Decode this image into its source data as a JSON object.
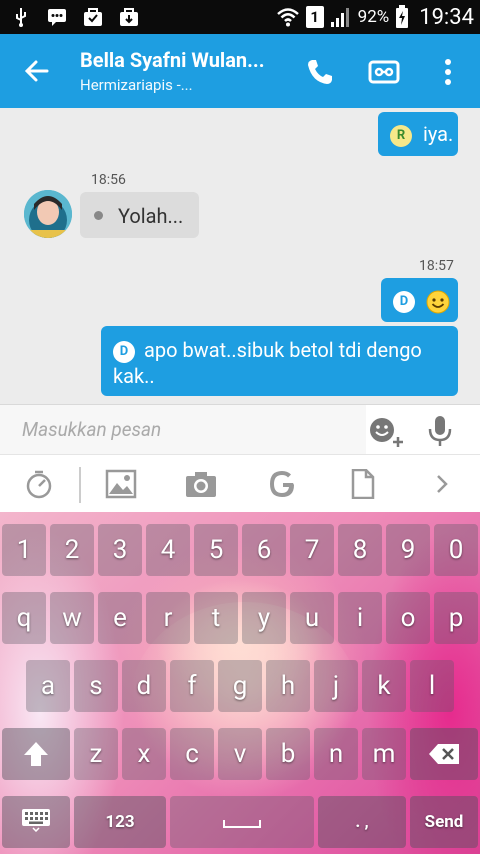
{
  "status_bar": {
    "battery_percent": "92%",
    "time": "19:34",
    "sim_slot": "1",
    "icons": [
      "usb-icon",
      "chat-notification-icon",
      "bag-icon",
      "bag-icon",
      "wifi-icon",
      "sim-icon",
      "signal-icon",
      "battery-icon"
    ]
  },
  "app_bar": {
    "title": "Bella Syafni Wulan...",
    "subtitle": "Hermizariapis -...",
    "accent": "#1e9ee1"
  },
  "messages": [
    {
      "direction": "out",
      "badge": "R",
      "text": "iya."
    },
    {
      "direction": "in",
      "time": "18:56",
      "text": "Yolah..."
    },
    {
      "direction": "out",
      "time": "18:57",
      "badge": "D",
      "text": ""
    },
    {
      "direction": "out",
      "badge": "D",
      "text": "apo bwat..sibuk betol tdi dengo kak.."
    }
  ],
  "composer": {
    "placeholder": "Masukkan pesan"
  },
  "keyboard": {
    "row1": [
      "1",
      "2",
      "3",
      "4",
      "5",
      "6",
      "7",
      "8",
      "9",
      "0"
    ],
    "row2": [
      "q",
      "w",
      "e",
      "r",
      "t",
      "y",
      "u",
      "i",
      "o",
      "p"
    ],
    "row3": [
      "a",
      "s",
      "d",
      "f",
      "g",
      "h",
      "j",
      "k",
      "l"
    ],
    "row4": [
      "z",
      "x",
      "c",
      "v",
      "b",
      "n",
      "m"
    ],
    "numbers_key": "123",
    "punct_key": ". ,",
    "send_key": "Send"
  }
}
